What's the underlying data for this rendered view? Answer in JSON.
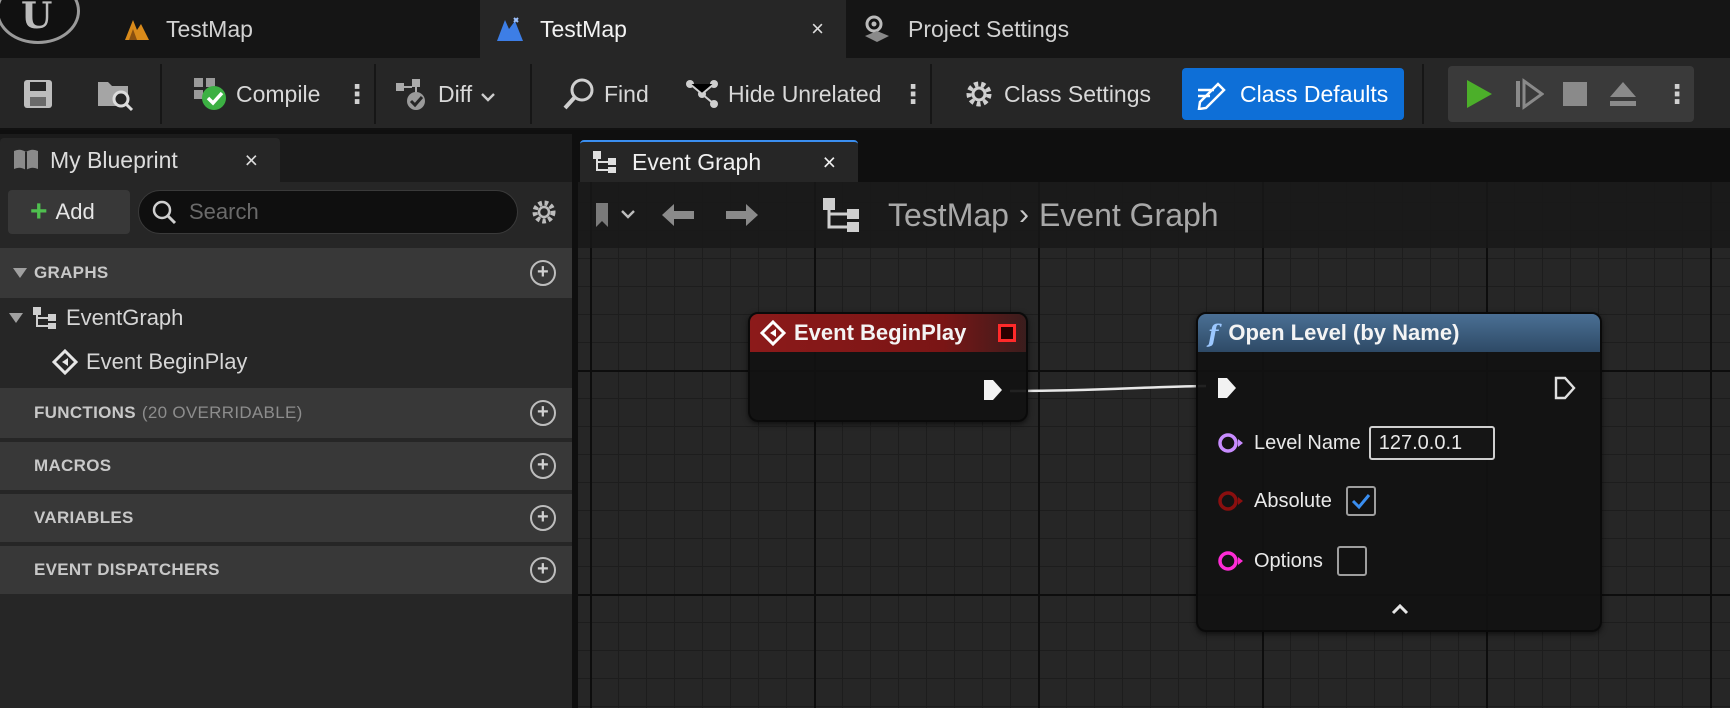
{
  "tabs": [
    {
      "label": "TestMap",
      "icon": "level-icon"
    },
    {
      "label": "TestMap",
      "icon": "blueprint-icon",
      "active": true,
      "close": "×"
    },
    {
      "label": "Project Settings",
      "icon": "settings-gear-icon"
    }
  ],
  "toolbar": {
    "compile_label": "Compile",
    "diff_label": "Diff",
    "find_label": "Find",
    "hide_unrelated_label": "Hide Unrelated",
    "class_settings_label": "Class Settings",
    "class_defaults_label": "Class Defaults",
    "accent_color": "#0e6fd7",
    "play_color": "#4caf2a"
  },
  "my_blueprint": {
    "tab_label": "My Blueprint",
    "close": "×",
    "add_label": "Add",
    "search_placeholder": "Search",
    "sections": {
      "graphs": "GRAPHS",
      "functions": "FUNCTIONS",
      "functions_sub": "(20 OVERRIDABLE)",
      "macros": "MACROS",
      "variables": "VARIABLES",
      "dispatchers": "EVENT DISPATCHERS"
    },
    "graph_items": {
      "event_graph": "EventGraph",
      "begin_play": "Event BeginPlay"
    }
  },
  "graph_editor": {
    "tab_label": "Event Graph",
    "close": "×",
    "breadcrumb": {
      "root": "TestMap",
      "current": "Event Graph"
    }
  },
  "nodes": {
    "begin_play": {
      "title": "Event BeginPlay",
      "color": "#8c1a1a"
    },
    "open_level": {
      "title": "Open Level (by Name)",
      "color": "#3f6689",
      "level_name_label": "Level Name",
      "level_name_value": "127.0.0.1",
      "absolute_label": "Absolute",
      "absolute_checked": true,
      "options_label": "Options",
      "options_checked": false
    }
  }
}
